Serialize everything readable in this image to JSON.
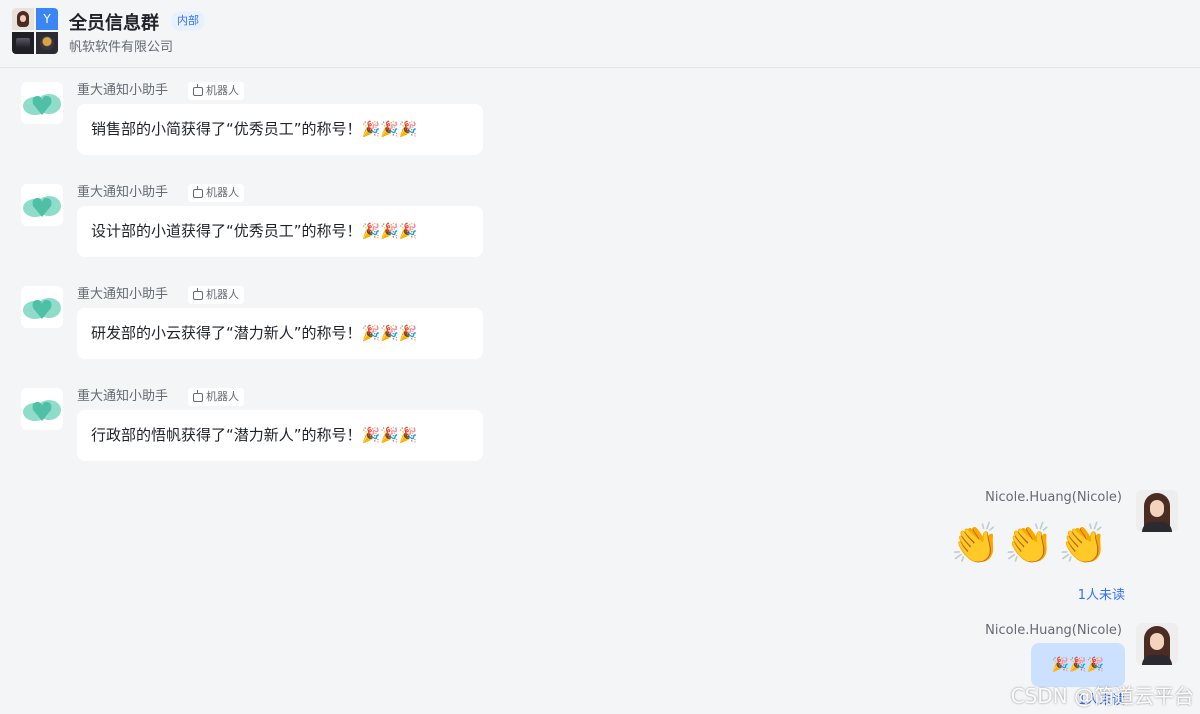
{
  "header": {
    "title": "全员信息群",
    "tag": "内部",
    "subtitle": "帆软软件有限公司",
    "avatar_letter": "Y"
  },
  "messages": [
    {
      "sender": "重大通知小助手",
      "badge": "机器人",
      "text": "销售部的小简获得了“优秀员工”的称号！🎉🎉🎉"
    },
    {
      "sender": "重大通知小助手",
      "badge": "机器人",
      "text": "设计部的小道获得了“优秀员工”的称号！🎉🎉🎉"
    },
    {
      "sender": "重大通知小助手",
      "badge": "机器人",
      "text": "研发部的小云获得了“潜力新人”的称号！🎉🎉🎉"
    },
    {
      "sender": "重大通知小助手",
      "badge": "机器人",
      "text": "行政部的悟帆获得了“潜力新人”的称号！🎉🎉🎉"
    }
  ],
  "own_messages": [
    {
      "sender": "Nicole.Huang(Nicole)",
      "content": "👏👏👏",
      "status": "1人未读"
    },
    {
      "sender": "Nicole.Huang(Nicole)",
      "content": "🎉🎉🎉",
      "status": "1人未读"
    }
  ],
  "watermark": "CSDN @简道云平台",
  "colors": {
    "accent": "#3370ff",
    "bot_logo": "#5cc8b4",
    "own_bubble": "#cce0ff"
  }
}
